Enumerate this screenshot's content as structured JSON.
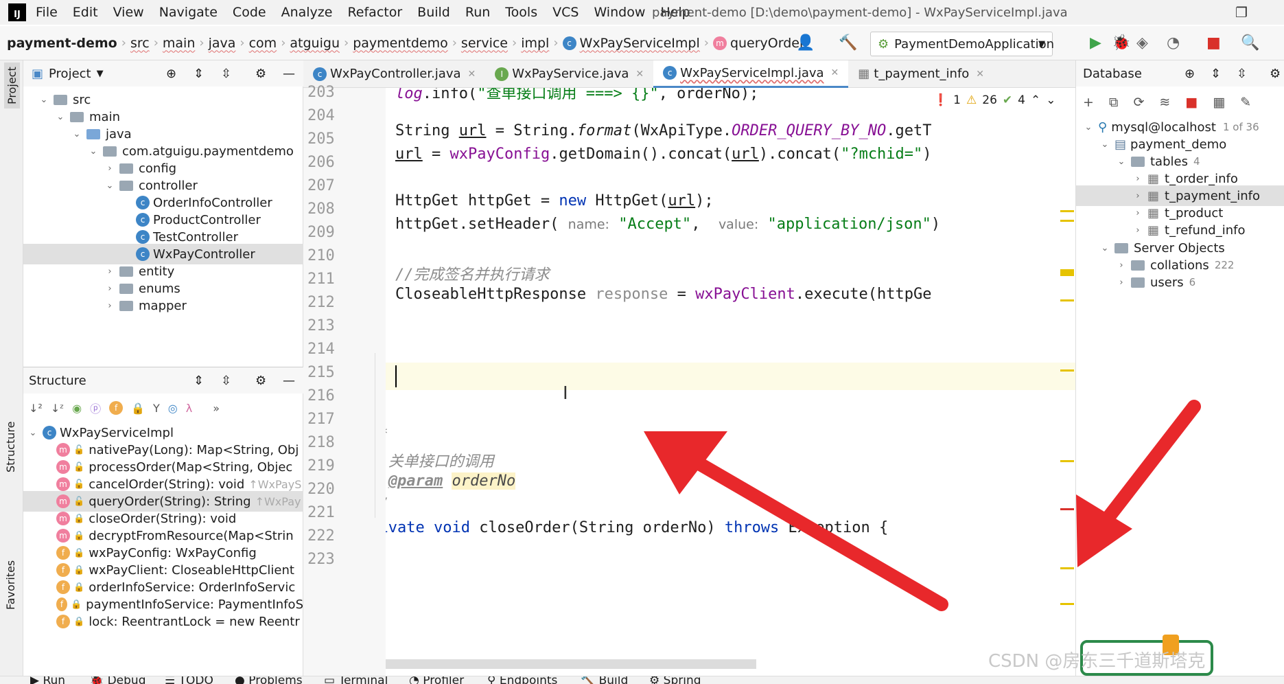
{
  "app": {
    "logo": "IJ",
    "window_title": "payment-demo [D:\\demo\\payment-demo] - WxPayServiceImpl.java",
    "menu": [
      "File",
      "Edit",
      "View",
      "Navigate",
      "Code",
      "Analyze",
      "Refactor",
      "Build",
      "Run",
      "Tools",
      "VCS",
      "Window",
      "Help"
    ]
  },
  "breadcrumb": [
    "payment-demo",
    "src",
    "main",
    "java",
    "com",
    "atguigu",
    "paymentdemo",
    "service",
    "impl",
    "WxPayServiceImpl",
    "queryOrder"
  ],
  "run_config": "PaymentDemoApplication",
  "project_panel": {
    "title": "Project",
    "tree": [
      {
        "label": "src",
        "depth": 1,
        "arrow": "open",
        "kind": "folder"
      },
      {
        "label": "main",
        "depth": 2,
        "arrow": "open",
        "kind": "folder"
      },
      {
        "label": "java",
        "depth": 3,
        "arrow": "open",
        "kind": "folder-blue"
      },
      {
        "label": "com.atguigu.paymentdemo",
        "depth": 4,
        "arrow": "open",
        "kind": "folder"
      },
      {
        "label": "config",
        "depth": 5,
        "arrow": "closed",
        "kind": "folder"
      },
      {
        "label": "controller",
        "depth": 5,
        "arrow": "open",
        "kind": "folder"
      },
      {
        "label": "OrderInfoController",
        "depth": 6,
        "arrow": "",
        "kind": "class"
      },
      {
        "label": "ProductController",
        "depth": 6,
        "arrow": "",
        "kind": "class"
      },
      {
        "label": "TestController",
        "depth": 6,
        "arrow": "",
        "kind": "class"
      },
      {
        "label": "WxPayController",
        "depth": 6,
        "arrow": "",
        "kind": "class",
        "selected": true
      },
      {
        "label": "entity",
        "depth": 5,
        "arrow": "closed",
        "kind": "folder"
      },
      {
        "label": "enums",
        "depth": 5,
        "arrow": "closed",
        "kind": "folder"
      },
      {
        "label": "mapper",
        "depth": 5,
        "arrow": "closed",
        "kind": "folder"
      }
    ]
  },
  "structure_panel": {
    "title": "Structure",
    "root": "WxPayServiceImpl",
    "members": [
      {
        "icon": "m",
        "label": "nativePay(Long): Map<String, Obj",
        "suffix": ""
      },
      {
        "icon": "m",
        "label": "processOrder(Map<String, Objec",
        "suffix": ""
      },
      {
        "icon": "m",
        "label": "cancelOrder(String): void",
        "suffix": "↑WxPayS"
      },
      {
        "icon": "m",
        "label": "queryOrder(String): String",
        "suffix": "↑WxPay",
        "selected": true
      },
      {
        "icon": "m",
        "label": "closeOrder(String): void",
        "suffix": "",
        "locked": true
      },
      {
        "icon": "m",
        "label": "decryptFromResource(Map<Strin",
        "suffix": "",
        "locked": true
      },
      {
        "icon": "f",
        "label": "wxPayConfig: WxPayConfig",
        "suffix": "",
        "locked": true
      },
      {
        "icon": "f",
        "label": "wxPayClient: CloseableHttpClient",
        "suffix": "",
        "locked": true
      },
      {
        "icon": "f",
        "label": "orderInfoService: OrderInfoServic",
        "suffix": "",
        "locked": true
      },
      {
        "icon": "f",
        "label": "paymentInfoService: PaymentInfoS",
        "suffix": "",
        "locked": true
      },
      {
        "icon": "f",
        "label": "lock: ReentrantLock = new Reentr",
        "suffix": "",
        "locked": true
      }
    ]
  },
  "editor_tabs": [
    {
      "label": "WxPayController.java",
      "icon": "class"
    },
    {
      "label": "WxPayService.java",
      "icon": "interface"
    },
    {
      "label": "WxPayServiceImpl.java",
      "icon": "class",
      "active": true
    },
    {
      "label": "t_payment_info",
      "icon": "table"
    }
  ],
  "inspections": {
    "errors": "1",
    "warnings": "26",
    "weak": "4"
  },
  "code": {
    "line_numbers": [
      "203",
      "204",
      "205",
      "206",
      "207",
      "208",
      "209",
      "210",
      "211",
      "212",
      "213",
      "214",
      "215",
      "216",
      "217",
      "218",
      "219",
      "220",
      "221",
      "222",
      "223"
    ],
    "l203_a": "log",
    "l203_b": ".info(",
    "l203_c": "\"查单接口调用 ===> {}\"",
    "l203_d": ", orderNo);",
    "l205_a": "String ",
    "l205_b": "url",
    "l205_c": " = String.",
    "l205_d": "format",
    "l205_e": "(WxApiType.",
    "l205_f": "ORDER_QUERY_BY_NO",
    "l205_g": ".getT",
    "l206_a": "url",
    "l206_b": " = ",
    "l206_c": "wxPayConfig",
    "l206_d": ".getDomain().concat(",
    "l206_e": "url",
    "l206_f": ").concat(",
    "l206_g": "\"?mchid=\"",
    "l206_h": ")",
    "l208_a": "HttpGet httpGet = ",
    "l208_b": "new",
    "l208_c": " HttpGet(",
    "l208_d": "url",
    "l208_e": ");",
    "l209_a": "httpGet.setHeader( ",
    "l209_b": "name:",
    "l209_c": " \"Accept\"",
    "l209_d": ",  ",
    "l209_e": "value:",
    "l209_f": " \"application/json\"",
    "l209_g": ")",
    "l211": "//完成签名并执行请求",
    "l212_a": "CloseableHttpResponse ",
    "l212_b": "response",
    "l212_c": " = ",
    "l212_d": "wxPayClient",
    "l212_e": ".execute(httpGe",
    "l215": "}",
    "l218": "/**",
    "l219": " * 关单接口的调用",
    "l220_a": " * ",
    "l220_b": "@param",
    "l220_c": " ",
    "l220_d": "orderNo",
    "l221": " */",
    "l222_a": "private",
    "l222_b": " ",
    "l222_c": "void",
    "l222_d": " closeOrder(String orderNo) ",
    "l222_e": "throws",
    "l222_f": " Exception {"
  },
  "database_panel": {
    "title": "Database",
    "connection": "mysql@localhost",
    "connection_badge": "1 of 36",
    "schema": "payment_demo",
    "tables_label": "tables",
    "tables_count": "4",
    "tables": [
      "t_order_info",
      "t_payment_info",
      "t_product",
      "t_refund_info"
    ],
    "selected_table": "t_payment_info",
    "server_objects": "Server Objects",
    "collations": "collations",
    "collations_count": "222",
    "users": "users",
    "users_count": "6"
  },
  "side_labels": {
    "project": "Project",
    "structure": "Structure",
    "favorites": "Favorites"
  },
  "bottom_tools": [
    "Run",
    "Debug",
    "TODO",
    "Problems",
    "Terminal",
    "Profiler",
    "Endpoints",
    "Build",
    "Spring"
  ],
  "watermark": "CSDN @房东三千道斯塔克",
  "colors": {
    "arrow": "#e8282b",
    "accent": "#4a88c7"
  }
}
